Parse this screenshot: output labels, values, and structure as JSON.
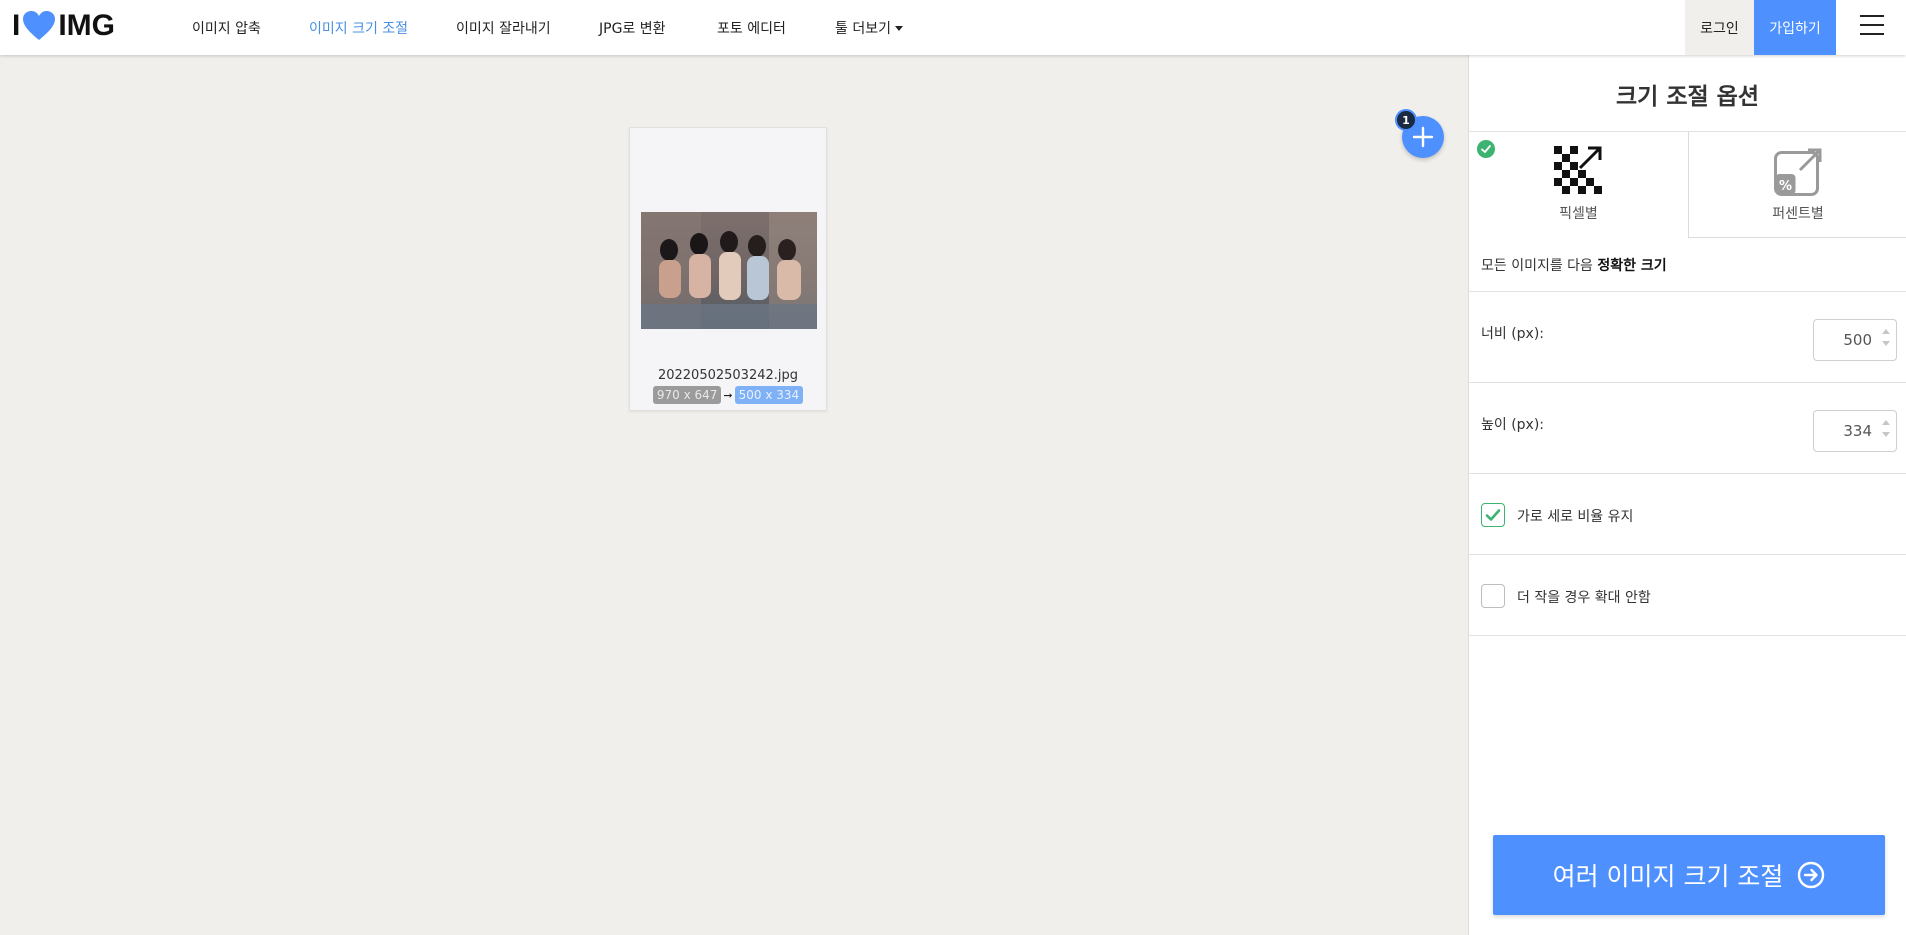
{
  "header": {
    "logo_text_left": "I",
    "logo_text_right": "IMG",
    "nav": [
      {
        "label": "이미지 압축",
        "active": false
      },
      {
        "label": "이미지 크기 조절",
        "active": true
      },
      {
        "label": "이미지 잘라내기",
        "active": false
      },
      {
        "label": "JPG로 변환",
        "active": false
      },
      {
        "label": "포토 에디터",
        "active": false
      },
      {
        "label": "툴 더보기",
        "active": false
      }
    ],
    "login_label": "로그인",
    "signup_label": "가입하기"
  },
  "workspace": {
    "file_count": "1",
    "file": {
      "name": "20220502503242.jpg",
      "original_size": "970 x 647",
      "new_size": "500 x 334"
    }
  },
  "sidebar": {
    "title": "크기 조절 옵션",
    "modes": [
      {
        "label": "픽셀별",
        "selected": true
      },
      {
        "label": "퍼센트별",
        "selected": false
      }
    ],
    "description_prefix": "모든 이미지를 다음",
    "description_bold": "정확한 크기",
    "width_label": "너비 (px):",
    "width_value": "500",
    "height_label": "높이 (px):",
    "height_value": "334",
    "keep_ratio_label": "가로 세로 비율 유지",
    "keep_ratio_checked": true,
    "no_enlarge_label": "더 작을 경우 확대 안함",
    "no_enlarge_checked": false,
    "cta_label": "여러 이미지 크기 조절"
  },
  "colors": {
    "accent": "#4d90fe",
    "success": "#3cb371",
    "workspace_bg": "#f1efeb"
  }
}
